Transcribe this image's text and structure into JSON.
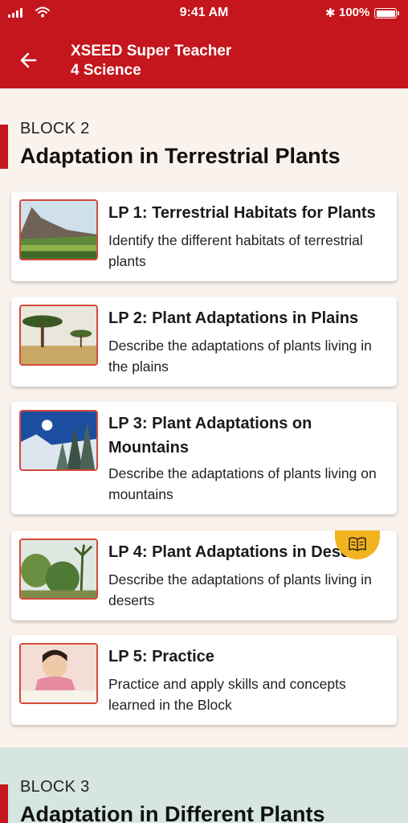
{
  "status_bar": {
    "time": "9:41 AM",
    "battery": "100%"
  },
  "header": {
    "title_line1": "XSEED Super Teacher",
    "title_line2": "4 Science"
  },
  "blocks": [
    {
      "label": "BLOCK 2",
      "title": "Adaptation in  Terrestrial Plants",
      "lessons": [
        {
          "title": "LP 1: Terrestrial Habitats for Plants",
          "description": "Identify the different habitats of terrestrial plants"
        },
        {
          "title": "LP 2: Plant Adaptations in Plains",
          "description": "Describe the adaptations of plants living in the plains"
        },
        {
          "title": "LP 3: Plant Adaptations on Mountains",
          "description": "Describe the adaptations of plants living on mountains"
        },
        {
          "title": "LP 4: Plant Adaptations in Deserts",
          "description": "Describe the adaptations of plants living in deserts"
        },
        {
          "title": "LP 5: Practice",
          "description": "Practice and apply skills and concepts learned in the Block"
        }
      ]
    },
    {
      "label": "BLOCK 3",
      "title": "Adaptation in Different Plants"
    }
  ],
  "colors": {
    "brand_red": "#c4161c",
    "page_bg": "#faf2ec",
    "fab_yellow": "#f2b321",
    "next_block_bg": "#d6e5e0"
  },
  "icons": {
    "back": "arrow-left-icon",
    "fab": "book-icon"
  }
}
